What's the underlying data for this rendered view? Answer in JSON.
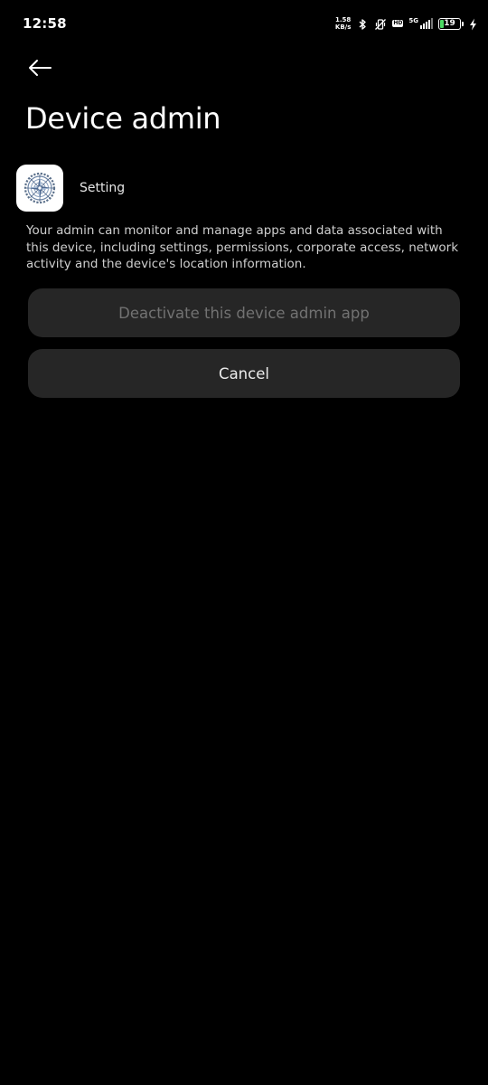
{
  "status_bar": {
    "time": "12:58",
    "net_speed_value": "1.58",
    "net_speed_unit": "KB/s",
    "hd_label": "HD",
    "network_label": "5G",
    "battery_level": "19",
    "battery_fraction": 0.19,
    "icons": [
      "bluetooth-icon",
      "vibrate-off-icon",
      "hd-icon",
      "signal-icon",
      "battery-icon",
      "charging-icon"
    ]
  },
  "header": {
    "back_icon": "back-arrow-icon",
    "title": "Device admin"
  },
  "app": {
    "name": "Setting",
    "icon": "gear-compass-icon"
  },
  "description": "Your admin can monitor and manage apps and data associated with this device, including settings, permissions, corporate access, network activity and the device's location information.",
  "actions": {
    "deactivate_label": "Deactivate this device admin app",
    "cancel_label": "Cancel"
  },
  "colors": {
    "background": "#000000",
    "button_background": "#262626",
    "disabled_text": "#727272",
    "battery_green": "#4cd964"
  }
}
